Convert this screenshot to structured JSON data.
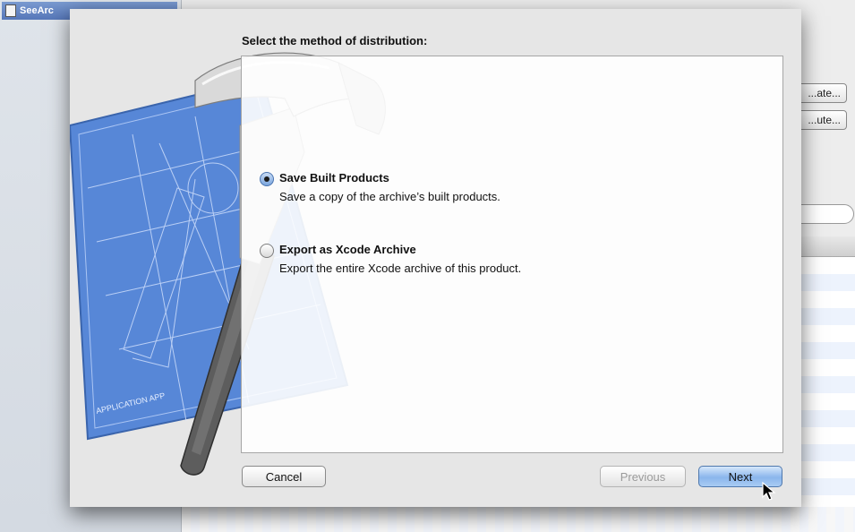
{
  "background_window": {
    "sidebar_selected_label": "SeeArc",
    "button_1_label": "...ate...",
    "button_2_label": "...ute..."
  },
  "dialog": {
    "heading": "Select the method of distribution:",
    "options": [
      {
        "title": "Save Built Products",
        "description": "Save a copy of the archive’s built products.",
        "selected": true
      },
      {
        "title": "Export as Xcode Archive",
        "description": "Export the entire Xcode archive of this product.",
        "selected": false
      }
    ],
    "buttons": {
      "cancel": "Cancel",
      "previous": "Previous",
      "next": "Next"
    },
    "artwork_label": "APPLICATION APP"
  },
  "colors": {
    "blueprint": "#4a7fd4",
    "default_button": "#8ab6ec",
    "sheet_background": "#e6e6e6"
  }
}
